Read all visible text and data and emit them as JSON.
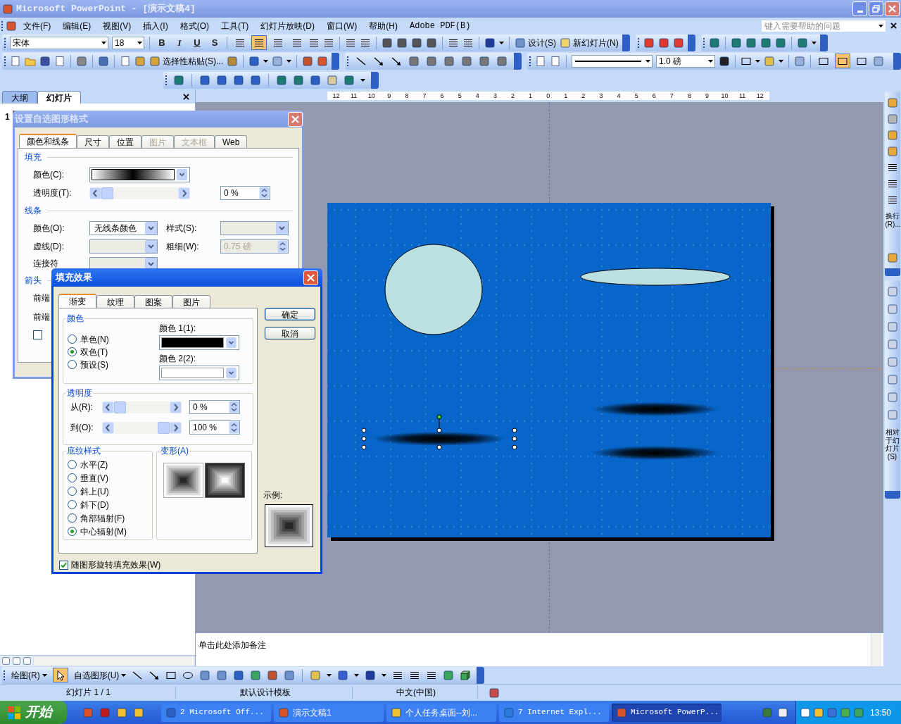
{
  "window": {
    "title": "Microsoft PowerPoint - [演示文稿4]"
  },
  "menu": [
    "文件(F)",
    "编辑(E)",
    "视图(V)",
    "插入(I)",
    "格式(O)",
    "工具(T)",
    "幻灯片放映(D)",
    "窗口(W)",
    "帮助(H)",
    "Adobe PDF(B)"
  ],
  "help_box": {
    "placeholder": "键入需要帮助的问题"
  },
  "formatting": {
    "font": "宋体",
    "size": "18",
    "style_buttons": [
      "B",
      "I",
      "U",
      "S"
    ],
    "alignment": [
      {
        "selected": false
      },
      {
        "selected": true
      },
      {
        "selected": false
      },
      {
        "selected": false
      }
    ],
    "design": "设计(S)",
    "new_slide": "新幻灯片(N)"
  },
  "standard": {
    "paste_special": "选择性粘贴(S)...",
    "line_weight": "1.0 磅",
    "border_toggles": [
      {
        "selected": false
      },
      {
        "selected": true
      },
      {
        "selected": false
      }
    ]
  },
  "pane_tabs": [
    {
      "label": "大纲",
      "selected": false
    },
    {
      "label": "幻灯片",
      "selected": true
    }
  ],
  "slide_number": "1",
  "ruler": [
    "12",
    "11",
    "10",
    "9",
    "8",
    "7",
    "6",
    "5",
    "4",
    "3",
    "2",
    "1",
    "0",
    "1",
    "2",
    "3",
    "4",
    "5",
    "6",
    "7",
    "8",
    "9",
    "10",
    "11",
    "12"
  ],
  "right_toolbar": {
    "wrap": "换行(R)...",
    "relative": "相对于幻灯片(S)"
  },
  "notes_prompt": "单击此处添加备注",
  "drawing_toolbar": {
    "draw": "绘图(R)",
    "select_objects": {
      "selected": true
    },
    "autoshapes": "自选图形(U)"
  },
  "status_bar": [
    "幻灯片 1 / 1",
    "默认设计模板",
    "中文(中国)"
  ],
  "taskbar": {
    "start": "开始",
    "tasks": [
      {
        "label": "2 Microsoft Off...",
        "selected": false
      },
      {
        "label": "演示文稿1",
        "selected": false
      },
      {
        "label": "个人任务桌面--刘...",
        "selected": false
      },
      {
        "label": "7 Internet Expl...",
        "selected": false
      },
      {
        "label": "Microsoft PowerP...",
        "selected": true
      }
    ],
    "clock": "13:50"
  },
  "format_dialog": {
    "title": "设置自选图形格式",
    "tabs": [
      {
        "label": "颜色和线条",
        "selected": true,
        "disabled": false
      },
      {
        "label": "尺寸",
        "selected": false,
        "disabled": false
      },
      {
        "label": "位置",
        "selected": false,
        "disabled": false
      },
      {
        "label": "图片",
        "selected": false,
        "disabled": true
      },
      {
        "label": "文本框",
        "selected": false,
        "disabled": true
      },
      {
        "label": "Web",
        "selected": false,
        "disabled": false
      }
    ],
    "fill_section": "填充",
    "fill_color_label": "颜色(C):",
    "transparency_label": "透明度(T):",
    "transparency_field": {
      "value": "0 %",
      "level": 0
    },
    "line_section": "线条",
    "line_color_label": "颜色(O):",
    "line_color_value": "无线条颜色",
    "style_label": "样式(S):",
    "dash_label": "虚线(D):",
    "weight_label": "粗细(W):",
    "weight_value": "0.75 磅",
    "connector_label": "连接符",
    "arrow_section": "箭头",
    "begin_style_label": "前端",
    "begin_size_label": "前端",
    "default_checkbox": {
      "checked": false
    }
  },
  "fill_dialog": {
    "title": "填充效果",
    "tabs": [
      {
        "label": "渐变",
        "selected": true
      },
      {
        "label": "纹理",
        "selected": false
      },
      {
        "label": "图案",
        "selected": false
      },
      {
        "label": "图片",
        "selected": false
      }
    ],
    "ok": "确定",
    "cancel": "取消",
    "color_group": "颜色",
    "color_modes": [
      {
        "label": "单色(N)",
        "selected": false
      },
      {
        "label": "双色(T)",
        "selected": true
      },
      {
        "label": "预设(S)",
        "selected": false
      }
    ],
    "color_pickers": [
      {
        "label": "颜色 1(1):",
        "color": "#000000"
      },
      {
        "label": "颜色 2(2):",
        "color": "#ffffff"
      }
    ],
    "transparency_group": "透明度",
    "transparency": [
      {
        "label": "从(R):",
        "value": "0 %",
        "level": 0
      },
      {
        "label": "到(O):",
        "value": "100 %",
        "level": 1
      }
    ],
    "shading_group": "底纹样式",
    "shading_styles": [
      {
        "label": "水平(Z)",
        "selected": false
      },
      {
        "label": "垂直(V)",
        "selected": false
      },
      {
        "label": "斜上(U)",
        "selected": false
      },
      {
        "label": "斜下(D)",
        "selected": false
      },
      {
        "label": "角部辐射(F)",
        "selected": false
      },
      {
        "label": "中心辐射(M)",
        "selected": true
      }
    ],
    "variants_group": "变形(A)",
    "variants": [
      {
        "kind": "dark-center"
      },
      {
        "kind": "light-center"
      }
    ],
    "sample_label": "示例:",
    "rotate_checkbox": {
      "label": "随图形旋转填充效果(W)",
      "checked": true
    }
  }
}
